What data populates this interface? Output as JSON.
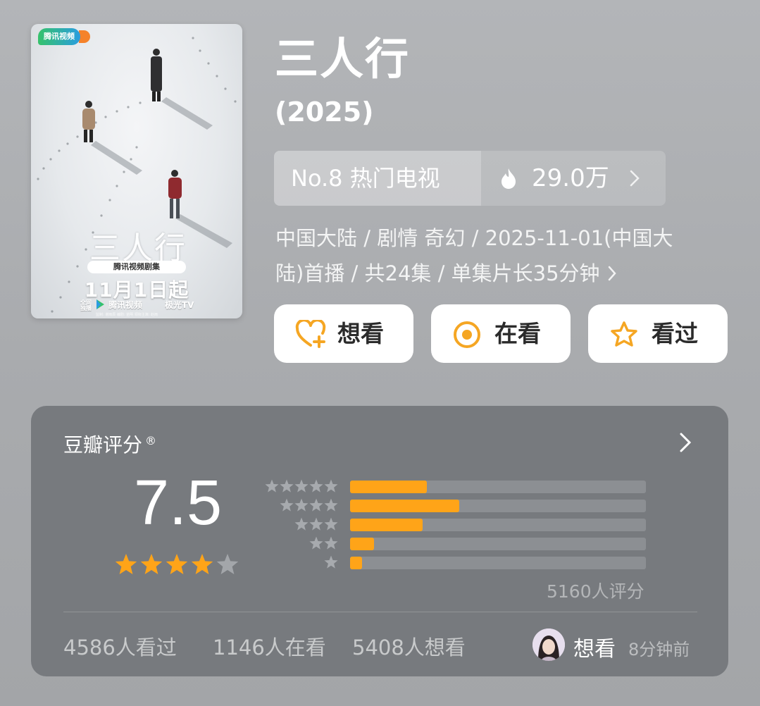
{
  "poster": {
    "logo_text": "腾讯视频",
    "calligraphy": "三人行",
    "banner": "腾讯视频剧集",
    "date": "11月1日起",
    "platform_label": "全网独播",
    "platform_1": "腾讯视频",
    "platform_2": "极光TV",
    "credits": "监制: 谢雨辰 编剧: 苗明 领衔主演: 赵雨"
  },
  "title": "三人行",
  "year": "(2025)",
  "rank": {
    "label": "No.8 热门电视",
    "heat": "29.0万"
  },
  "meta": {
    "line1": "中国大陆 / 剧情 奇幻 / 2025-11-01(中国大",
    "line2": "陆)首播 / 共24集 / 单集片长35分钟"
  },
  "actions": [
    {
      "label": "想看",
      "icon": "heart-plus-icon"
    },
    {
      "label": "在看",
      "icon": "target-icon"
    },
    {
      "label": "看过",
      "icon": "star-outline-icon"
    }
  ],
  "rating": {
    "title": "豆瓣评分",
    "registered_mark": "®",
    "score": "7.5",
    "stars_filled": 4,
    "distribution": [
      {
        "stars": 5,
        "fraction": 0.26
      },
      {
        "stars": 4,
        "fraction": 0.37
      },
      {
        "stars": 3,
        "fraction": 0.245
      },
      {
        "stars": 2,
        "fraction": 0.08
      },
      {
        "stars": 1,
        "fraction": 0.04
      }
    ],
    "count": "5160人评分",
    "seen": "4586人看过",
    "watching": "1146人在看",
    "want": "5408人想看",
    "recent_action": "想看",
    "recent_time": "8分钟前"
  },
  "colors": {
    "accent": "#ffa418",
    "icon_orange": "#f5a623",
    "card_bg": "#777a7e"
  }
}
